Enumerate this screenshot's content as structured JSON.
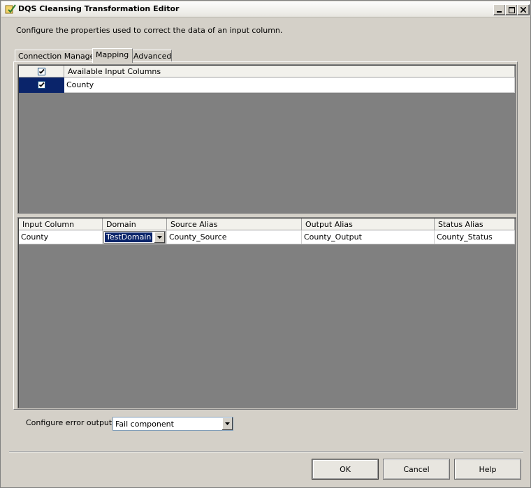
{
  "window": {
    "title": "DQS Cleansing Transformation Editor"
  },
  "description": "Configure the properties used to correct the data of an input column.",
  "tabs": [
    "Connection Manager",
    "Mapping",
    "Advanced"
  ],
  "available_columns": {
    "header": "Available Input Columns",
    "rows": [
      {
        "name": "County",
        "checked": true
      }
    ]
  },
  "mapping": {
    "headers": [
      "Input Column",
      "Domain",
      "Source Alias",
      "Output Alias",
      "Status Alias"
    ],
    "rows": [
      {
        "input_column": "County",
        "domain": "TestDomain",
        "source_alias": "County_Source",
        "output_alias": "County_Output",
        "status_alias": "County_Status"
      }
    ]
  },
  "error_output": {
    "label": "Configure error output:",
    "value": "Fail component"
  },
  "buttons": {
    "ok": "OK",
    "cancel": "Cancel",
    "help": "Help"
  }
}
